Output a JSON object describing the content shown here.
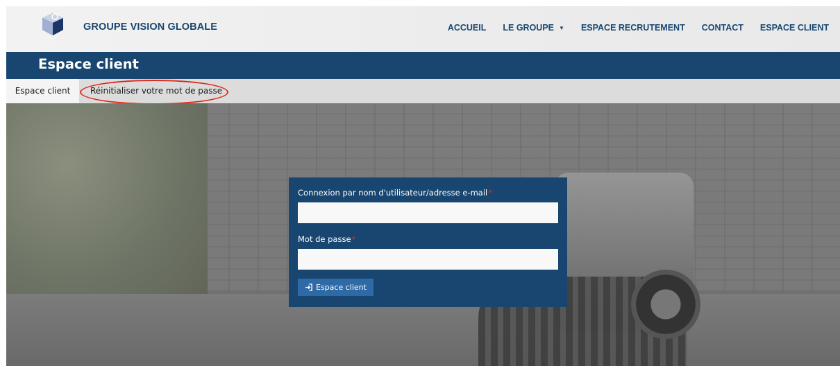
{
  "brand": {
    "name": "GROUPE VISION GLOBALE",
    "logo_icon": "cube-logo-icon"
  },
  "nav": {
    "items": [
      {
        "label": "ACCUEIL"
      },
      {
        "label": "LE GROUPE",
        "dropdown": true
      },
      {
        "label": "ESPACE RECRUTEMENT"
      },
      {
        "label": "CONTACT"
      },
      {
        "label": "ESPACE CLIENT"
      }
    ],
    "caret_icon": "caret-down-icon"
  },
  "page": {
    "title": "Espace client"
  },
  "tabs": {
    "active": "Espace client",
    "reset": "Réinitialiser votre mot de passe"
  },
  "login": {
    "username_label": "Connexion par nom d'utilisateur/adresse e-mail",
    "username_value": "",
    "password_label": "Mot de passe",
    "password_value": "",
    "required_mark": "*",
    "submit_label": "Espace client",
    "submit_icon": "sign-in-icon"
  },
  "colors": {
    "brand_navy": "#184670",
    "button_blue": "#2e6aa6",
    "required_red": "#e02a1a",
    "highlight_circle": "#e02a1a"
  }
}
